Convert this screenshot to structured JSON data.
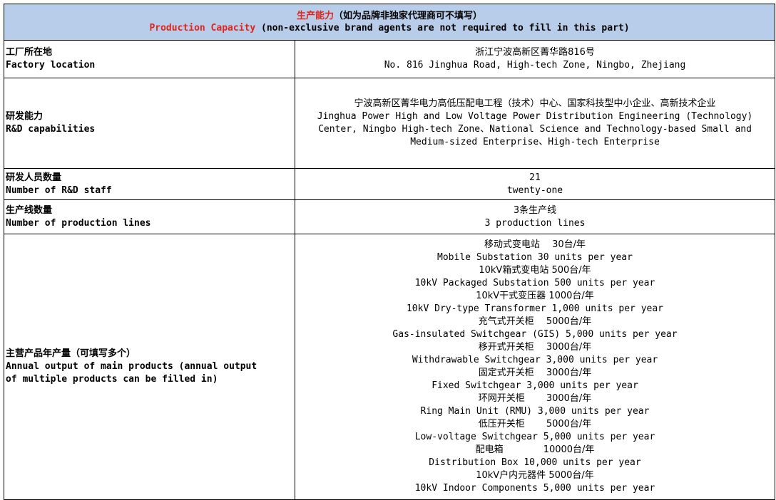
{
  "header": {
    "title_cn": "生产能力",
    "title_cn_note": "（如为品牌非独家代理商可不填写）",
    "title_en": "Production Capacity",
    "title_en_note": " (non-exclusive brand agents are not required to fill in this part)"
  },
  "rows": [
    {
      "label_cn": "工厂所在地",
      "label_en": "Factory location",
      "value_lines": [
        "浙江宁波高新区菁华路816号",
        "No. 816 Jinghua Road, High-tech Zone, Ningbo, Zhejiang"
      ]
    },
    {
      "label_cn": "研发能力",
      "label_en": "R&D capabilities",
      "value_cn": "宁波高新区菁华电力高低压配电工程（技术）中心、国家科技型中小企业、高新技术企业",
      "value_en": "Jinghua Power High and Low Voltage Power Distribution Engineering (Technology) Center, Ningbo High-tech Zone、National Science and Technology-based Small and Medium-sized Enterprise、High-tech Enterprise"
    },
    {
      "label_cn": "研发人员数量",
      "label_en": "Number of R&D staff",
      "value_lines": [
        "21",
        "twenty-one"
      ]
    },
    {
      "label_cn": "生产线数量",
      "label_en": "Number of production lines",
      "value_lines": [
        "3条生产线",
        "3 production lines"
      ]
    },
    {
      "label_cn": "主营产品年产量（可填写多个）",
      "label_en": "Annual output of main products (annual output of multiple products can be filled in)",
      "value_lines": [
        "移动式变电站　  30台/年",
        "Mobile Substation  30 units per year",
        "10kV箱式变电站  500台/年",
        "10kV Packaged Substation 500 units per year",
        "10kV干式变压器  1000台/年",
        "10kV Dry-type Transformer 1,000 units per year",
        "充气式开关柜　   5000台/年",
        "Gas-insulated Switchgear (GIS) 5,000 units per year",
        "移开式开关柜　   3000台/年",
        "Withdrawable Switchgear 3,000 units per year",
        "固定式开关柜　   3000台/年",
        "Fixed Switchgear 3,000 units per year",
        "环网开关柜　　   3000台/年",
        "Ring Main Unit (RMU) 3,000 units per year",
        "低压开关柜　　   5000台/年",
        "Low-voltage Switchgear 5,000 units per year",
        "配电箱　　　　  10000台/年",
        "Distribution Box 10,000 units per year",
        "10kV户内元器件   5000台/年",
        "10kV Indoor Components 5,000 units per year"
      ]
    }
  ]
}
